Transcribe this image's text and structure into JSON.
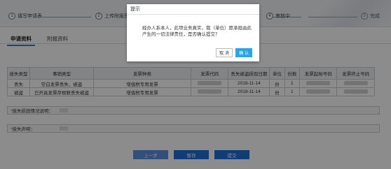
{
  "steps": [
    {
      "num": "1",
      "label": "填写申请表"
    },
    {
      "num": "2",
      "label": "上传附报资料"
    },
    {
      "num": "4",
      "label": "审核中"
    },
    {
      "num": "5",
      "label": "完成"
    }
  ],
  "tabs": [
    "申请资料",
    "附报资料"
  ],
  "table": {
    "headers": [
      "挂失类型",
      "事销类型",
      "发票种类",
      "发票代码",
      "丢失被盗损毁日期",
      "单位",
      "份数",
      "发票起始号码",
      "发票终止号码"
    ],
    "rows": [
      [
        "丢失",
        "空白发票丢失、被盗",
        "增值税专用发票",
        "",
        "2018-11-14",
        "份",
        "1",
        "",
        ""
      ],
      [
        "被盗",
        "已开具发票存根联丢失被盗",
        "增值税专用发票",
        "",
        "2018-11-14",
        "份",
        "1",
        "",
        ""
      ]
    ]
  },
  "form": {
    "loss_desc_label": "挂失损毁情况说明：",
    "loss_statement_label": "挂失声明："
  },
  "buttons": {
    "prev": "上一步",
    "save": "暂存",
    "submit": "提交"
  },
  "dialog": {
    "title": "提示",
    "message": "经办人系本人，此项业务真实，我（单位）愿承担由此产生的一切法律责任，是否确认提交？",
    "cancel": "取 消",
    "confirm": "确 认"
  }
}
